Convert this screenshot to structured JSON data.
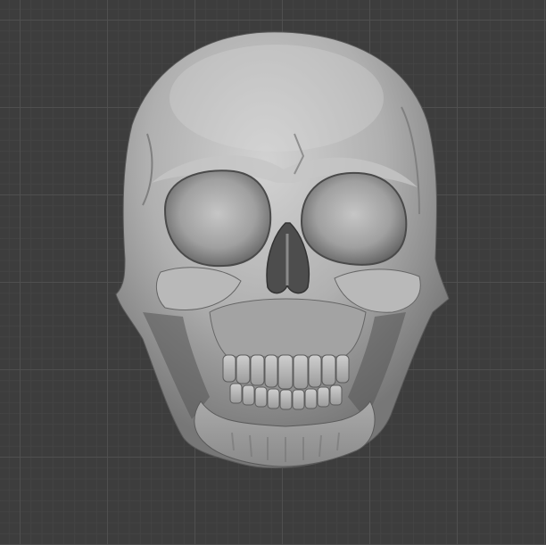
{
  "viewport": {
    "background_color": "#3d3d3d",
    "grid_major_color": "#505050",
    "grid_minor_color": "#444444"
  },
  "model": {
    "icon": "skull-model",
    "base_color": "#a9a9a9",
    "shadow_color": "#2b2b2b",
    "highlight_color": "#d0d0d0"
  }
}
